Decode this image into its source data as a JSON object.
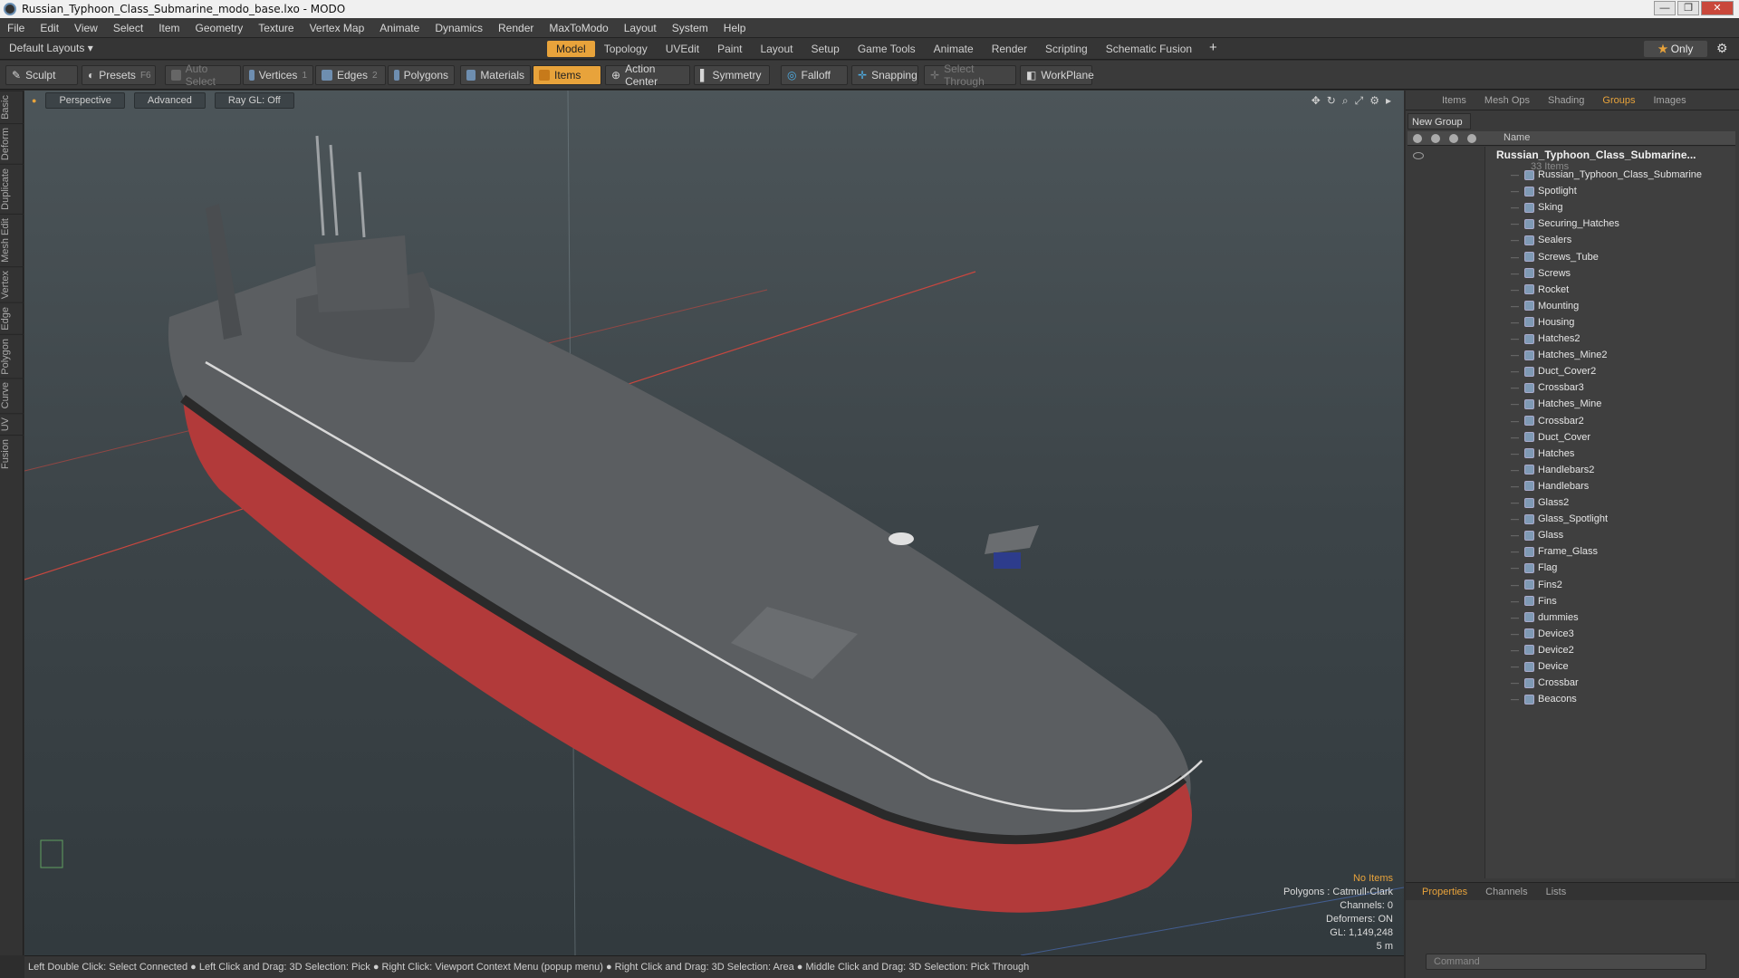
{
  "window": {
    "title": "Russian_Typhoon_Class_Submarine_modo_base.lxo - MODO"
  },
  "menu": [
    "File",
    "Edit",
    "View",
    "Select",
    "Item",
    "Geometry",
    "Texture",
    "Vertex Map",
    "Animate",
    "Dynamics",
    "Render",
    "MaxToModo",
    "Layout",
    "System",
    "Help"
  ],
  "layoutbar": {
    "default_layouts": "Default Layouts ▾",
    "tabs": [
      "Model",
      "Topology",
      "UVEdit",
      "Paint",
      "Layout",
      "Setup",
      "Game Tools",
      "Animate",
      "Render",
      "Scripting",
      "Schematic Fusion"
    ],
    "active_tab": "Model",
    "only": "Only"
  },
  "toolbar": {
    "sculpt": "Sculpt",
    "presets": "Presets",
    "presets_key": "F6",
    "auto_select": "Auto Select",
    "vertices": "Vertices",
    "vertices_count": "1",
    "edges": "Edges",
    "edges_count": "2",
    "polygons": "Polygons",
    "materials": "Materials",
    "items": "Items",
    "action_center": "Action Center",
    "symmetry": "Symmetry",
    "falloff": "Falloff",
    "snapping": "Snapping",
    "select_through": "Select Through",
    "workplane": "WorkPlane"
  },
  "left_tabs": [
    "Basic",
    "Deform",
    "Duplicate",
    "Mesh Edit",
    "Vertex",
    "Edge",
    "Polygon",
    "Curve",
    "UV",
    "Fusion"
  ],
  "viewport": {
    "perspective": "Perspective",
    "advanced": "Advanced",
    "raygl": "Ray GL: Off",
    "info": {
      "no_items": "No Items",
      "polygons": "Polygons : Catmull-Clark",
      "channels": "Channels: 0",
      "deformers": "Deformers: ON",
      "gl": "GL: 1,149,248",
      "scale": "5 m"
    }
  },
  "status": "Left Double Click: Select Connected ● Left Click and Drag: 3D Selection: Pick ● Right Click: Viewport Context Menu (popup menu) ● Right Click and Drag: 3D Selection: Area ● Middle Click and Drag: 3D Selection: Pick Through",
  "right_panel": {
    "tabs": [
      "Items",
      "Mesh Ops",
      "Shading",
      "Groups",
      "Images"
    ],
    "active_tab": "Groups",
    "new_group": "New Group",
    "name_header": "Name",
    "root": "Russian_Typhoon_Class_Submarine...",
    "root_count": "33 Items",
    "items": [
      "Russian_Typhoon_Class_Submarine",
      "Spotlight",
      "Sking",
      "Securing_Hatches",
      "Sealers",
      "Screws_Tube",
      "Screws",
      "Rocket",
      "Mounting",
      "Housing",
      "Hatches2",
      "Hatches_Mine2",
      "Duct_Cover2",
      "Crossbar3",
      "Hatches_Mine",
      "Crossbar2",
      "Duct_Cover",
      "Hatches",
      "Handlebars2",
      "Handlebars",
      "Glass2",
      "Glass_Spotlight",
      "Glass",
      "Frame_Glass",
      "Flag",
      "Fins2",
      "Fins",
      "dummies",
      "Device3",
      "Device2",
      "Device",
      "Crossbar",
      "Beacons"
    ],
    "bottom_tabs": [
      "Properties",
      "Channels",
      "Lists"
    ],
    "active_bottom": "Properties",
    "command_placeholder": "Command"
  },
  "colors": {
    "accent": "#e8a33b",
    "hull_red": "#b43a3a",
    "hull_grey": "#5a5d60"
  }
}
